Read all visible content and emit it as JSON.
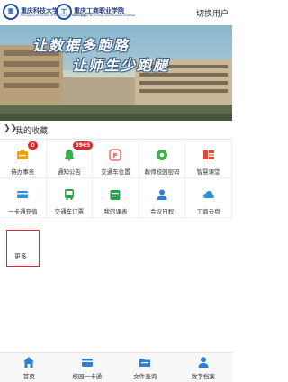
{
  "header": {
    "logo1_emblem": "重",
    "logo1_name": "重庆科技大学",
    "logo1_en": "Chongqing University of Science and Technology",
    "logo2_emblem": "工",
    "logo2_name": "重庆工商职业学院",
    "logo2_en": "Chongqing Technology and Business Institute",
    "switch_user": "切换用户"
  },
  "banner": {
    "slogan1": "让数据多跑路",
    "slogan2": "让师生少跑腿"
  },
  "favorites": {
    "title": "我的收藏",
    "items": [
      {
        "label": "待办事务",
        "icon": "todo-icon",
        "color": "#e8a317",
        "badge": "0"
      },
      {
        "label": "通知公告",
        "icon": "bell-icon",
        "color": "#36b24a",
        "badge": "3965"
      },
      {
        "label": "交通车位置",
        "icon": "bus-location-icon",
        "color": "#e8574e",
        "badge": ""
      },
      {
        "label": "教师校园密码",
        "icon": "password-icon",
        "color": "#3fae49",
        "badge": ""
      },
      {
        "label": "智慧课堂",
        "icon": "classroom-icon",
        "color": "#e0473c",
        "badge": ""
      },
      {
        "label": "一卡通充值",
        "icon": "card-icon",
        "color": "#2f8fd6",
        "badge": ""
      },
      {
        "label": "交通车订票",
        "icon": "bus-ticket-icon",
        "color": "#2ea24a",
        "badge": ""
      },
      {
        "label": "我的课表",
        "icon": "schedule-icon",
        "color": "#22a050",
        "badge": ""
      },
      {
        "label": "会议日程",
        "icon": "meeting-icon",
        "color": "#2f7fd1",
        "badge": ""
      },
      {
        "label": "工商云盘",
        "icon": "cloud-drive-icon",
        "color": "#2f8fd6",
        "badge": ""
      }
    ],
    "more_label": "更多"
  },
  "tabbar": {
    "items": [
      {
        "label": "首页",
        "icon": "home-icon"
      },
      {
        "label": "校园一卡通",
        "icon": "campus-card-icon"
      },
      {
        "label": "文件查询",
        "icon": "file-search-icon"
      },
      {
        "label": "数字档案",
        "icon": "profile-icon"
      }
    ]
  }
}
